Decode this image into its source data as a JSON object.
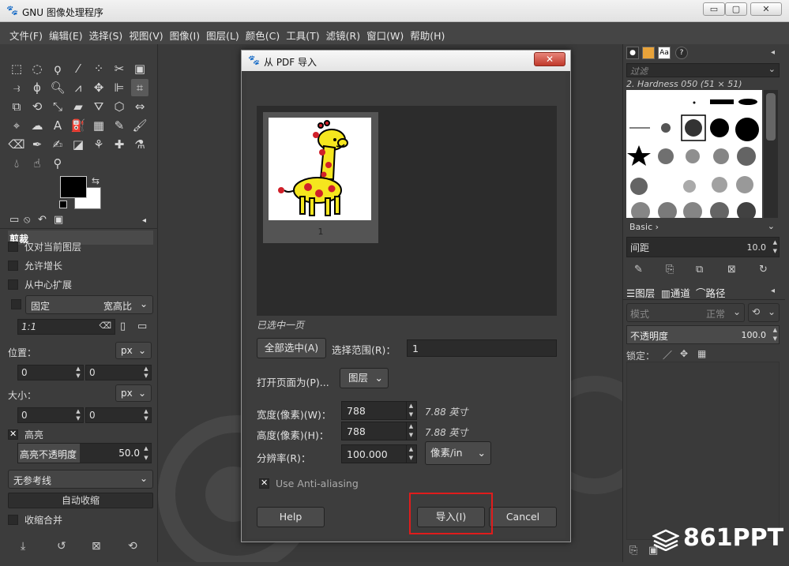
{
  "window": {
    "title": "GNU 图像处理程序",
    "minimize": "▭",
    "maximize": "▢",
    "close": "✕"
  },
  "menu": [
    "文件(F)",
    "编辑(E)",
    "选择(S)",
    "视图(V)",
    "图像(I)",
    "图层(L)",
    "颜色(C)",
    "工具(T)",
    "滤镜(R)",
    "窗口(W)",
    "帮助(H)"
  ],
  "tool_options": {
    "title": "剪裁",
    "current_layer_only": "仅对当前图层",
    "allow_growing": "允许增长",
    "expand_from_center": "从中心扩展",
    "fixed_label": "固定",
    "fixed_value": "宽高比",
    "ratio_value": "1:1",
    "position_label": "位置：",
    "position_unit": "px",
    "position_x": "0",
    "position_y": "0",
    "size_label": "大小：",
    "size_unit": "px",
    "size_w": "0",
    "size_h": "0",
    "highlight_label": "高亮",
    "highlight_opacity_label": "高亮不透明度",
    "highlight_opacity_value": "50.0",
    "guides_value": "无参考线",
    "auto_shrink": "自动收缩",
    "shrink_merged": "收缩合并"
  },
  "dialog": {
    "title": "从 PDF 导入",
    "close": "✕",
    "thumb_page_number": "1",
    "selected_status": "已选中一页",
    "select_all": "全部选中(A)",
    "select_range_label": "选择范围(R)：",
    "select_range_value": "1",
    "open_pages_as_label": "打开页面为(P)...",
    "open_pages_as_value": "图层",
    "width_label": "宽度(像素)(W)：",
    "width_value": "788",
    "width_inches": "7.88 英寸",
    "height_label": "高度(像素)(H)：",
    "height_value": "788",
    "height_inches": "7.88 英寸",
    "resolution_label": "分辨率(R)：",
    "resolution_value": "100.000",
    "resolution_unit": "像素/in",
    "antialias_label": "Use Anti-aliasing",
    "help_button": "Help",
    "import_button": "导入(I)",
    "cancel_button": "Cancel"
  },
  "brushes": {
    "filter_placeholder": "过滤",
    "brush_name": "2. Hardness 050 (51 × 51)",
    "set_name": "Basic ›",
    "spacing_label": "间距",
    "spacing_value": "10.0"
  },
  "layers": {
    "tab_layers": "图层",
    "tab_channels": "通道",
    "tab_paths": "路径",
    "mode_label": "模式",
    "mode_value": "正常",
    "opacity_label": "不透明度",
    "opacity_value": "100.0",
    "lock_label": "锁定："
  },
  "watermark": "861PPT",
  "colors": {
    "accent_highlight": "#e01c1c",
    "close_red": "#c0392b",
    "giraffe_yellow": "#f5e61e",
    "giraffe_spot": "#d0202a"
  }
}
